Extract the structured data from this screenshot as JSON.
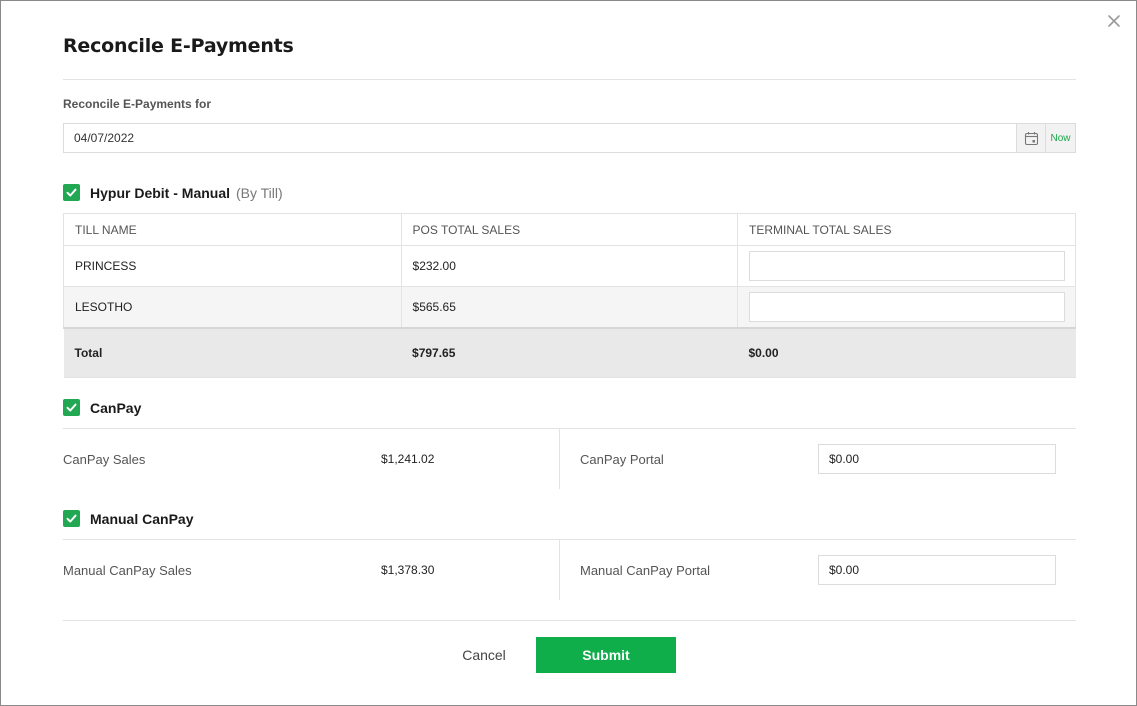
{
  "modal": {
    "title": "Reconcile E-Payments",
    "close_icon": "close-icon"
  },
  "date_field": {
    "label": "Reconcile E-Payments for",
    "value": "04/07/2022",
    "calendar_icon": "calendar-icon",
    "now_label": "Now"
  },
  "hypur": {
    "checked": true,
    "title": "Hypur Debit - Manual",
    "subtitle": "(By Till)",
    "columns": [
      "TILL NAME",
      "POS TOTAL SALES",
      "TERMINAL TOTAL SALES"
    ],
    "rows": [
      {
        "till_name": "PRINCESS",
        "pos_total": "$232.00",
        "terminal_value": ""
      },
      {
        "till_name": "LESOTHO",
        "pos_total": "$565.65",
        "terminal_value": ""
      }
    ],
    "total": {
      "label": "Total",
      "pos_total": "$797.65",
      "terminal_total": "$0.00"
    }
  },
  "canpay": {
    "checked": true,
    "title": "CanPay",
    "sales_label": "CanPay Sales",
    "sales_value": "$1,241.02",
    "portal_label": "CanPay Portal",
    "portal_value": "$0.00"
  },
  "manual_canpay": {
    "checked": true,
    "title": "Manual CanPay",
    "sales_label": "Manual CanPay Sales",
    "sales_value": "$1,378.30",
    "portal_label": "Manual CanPay Portal",
    "portal_value": "$0.00"
  },
  "footer": {
    "cancel_label": "Cancel",
    "submit_label": "Submit"
  },
  "colors": {
    "accent_green": "#0fae4b",
    "checkbox_green": "#22a852"
  }
}
